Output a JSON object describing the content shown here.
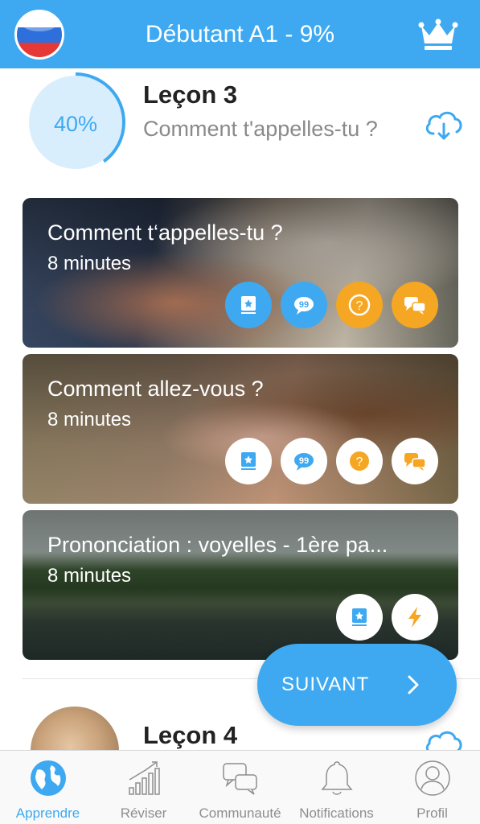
{
  "header": {
    "title": "Débutant A1 - 9%",
    "flag_icon": "russian-flag-icon",
    "premium_icon": "crown-icon",
    "color": "#3ea9f0"
  },
  "lesson3": {
    "progress_text": "40%",
    "progress_value": 0.4,
    "title": "Leçon 3",
    "subtitle": "Comment t'appelles-tu ?",
    "download_icon": "cloud-download-icon",
    "cards": [
      {
        "title": "Comment t‘appelles-tu ?",
        "duration": "8 minutes",
        "icons": [
          "vocabulary-icon",
          "dialogue-icon",
          "quiz-icon",
          "conversation-icon"
        ]
      },
      {
        "title": "Comment allez-vous ?",
        "duration": "8 minutes",
        "icons": [
          "vocabulary-icon",
          "dialogue-icon",
          "quiz-icon",
          "conversation-icon"
        ]
      },
      {
        "title": "Prononciation : voyelles - 1ère pa...",
        "duration": "8 minutes",
        "icons": [
          "vocabulary-icon",
          "lightning-icon"
        ]
      }
    ]
  },
  "lesson4": {
    "title": "Leçon 4",
    "download_icon": "cloud-download-icon"
  },
  "next_button": {
    "label": "SUIVANT",
    "icon": "chevron-right-icon"
  },
  "tabbar": {
    "tabs": [
      {
        "label": "Apprendre",
        "icon": "globe-icon",
        "active": true
      },
      {
        "label": "Réviser",
        "icon": "bar-chart-icon",
        "active": false
      },
      {
        "label": "Communauté",
        "icon": "chat-bubbles-icon",
        "active": false
      },
      {
        "label": "Notifications",
        "icon": "bell-icon",
        "active": false
      },
      {
        "label": "Profil",
        "icon": "profile-icon",
        "active": false
      }
    ]
  },
  "colors": {
    "accent": "#3ea9f0",
    "orange": "#f5a623",
    "inactive": "#8e8e8e"
  }
}
